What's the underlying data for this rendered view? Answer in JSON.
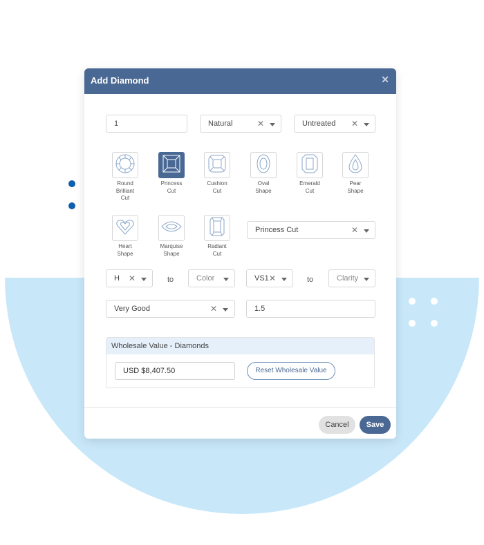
{
  "modal": {
    "title": "Add Diamond"
  },
  "row1": {
    "quantity": "1",
    "origin": "Natural",
    "treatment": "Untreated"
  },
  "shapes": [
    {
      "label": "Round\nBrilliant\nCut",
      "icon": "round-brilliant-icon",
      "selected": false
    },
    {
      "label": "Princess\nCut",
      "icon": "princess-cut-icon",
      "selected": true
    },
    {
      "label": "Cushion\nCut",
      "icon": "cushion-cut-icon",
      "selected": false
    },
    {
      "label": "Oval\nShape",
      "icon": "oval-shape-icon",
      "selected": false
    },
    {
      "label": "Emerald\nCut",
      "icon": "emerald-cut-icon",
      "selected": false
    },
    {
      "label": "Pear\nShape",
      "icon": "pear-shape-icon",
      "selected": false
    },
    {
      "label": "Heart\nShape",
      "icon": "heart-shape-icon",
      "selected": false
    },
    {
      "label": "Marquise\nShape",
      "icon": "marquise-shape-icon",
      "selected": false
    },
    {
      "label": "Radiant\nCut",
      "icon": "radiant-cut-icon",
      "selected": false
    }
  ],
  "shape_select": "Princess Cut",
  "color_range": {
    "from": "H",
    "to_label": "to",
    "to_placeholder": "Color"
  },
  "clarity_range": {
    "from": "VS1",
    "to_label": "to",
    "to_placeholder": "Clarity"
  },
  "cut_grade": "Very Good",
  "carat": "1.5",
  "wholesale": {
    "header": "Wholesale Value - Diamonds",
    "value": "USD $8,407.50",
    "reset_label": "Reset Wholesale Value"
  },
  "footer": {
    "cancel_label": "Cancel",
    "save_label": "Save"
  },
  "colors": {
    "header": "#4a6894",
    "accent_blue": "#0d5fb0",
    "background_blob": "#c8e8fa"
  }
}
